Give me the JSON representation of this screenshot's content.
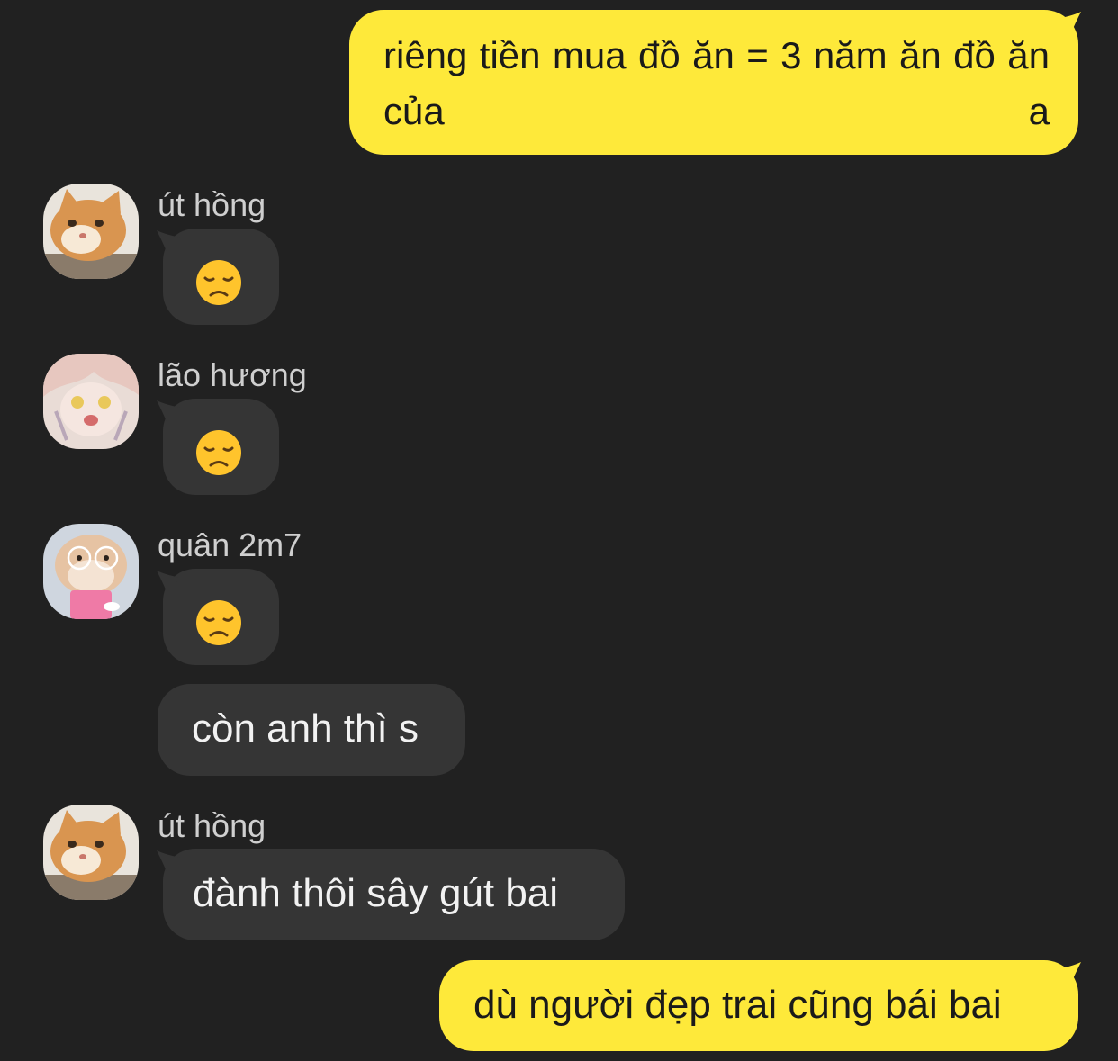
{
  "messages": {
    "m1": {
      "text": "riêng tiền mua đồ ăn = 3 năm ăn đồ ăn của a"
    },
    "m2": {
      "sender": "út hồng",
      "emoji": "disappointed-face"
    },
    "m3": {
      "sender": "lão hương",
      "emoji": "disappointed-face"
    },
    "m4": {
      "sender": "quân 2m7",
      "emoji": "disappointed-face"
    },
    "m5": {
      "text": "còn anh thì s"
    },
    "m6": {
      "sender": "út hồng",
      "text": "đành thôi sây gút bai"
    },
    "m7": {
      "text": "dù người đẹp trai cũng bái bai"
    }
  },
  "colors": {
    "background": "#212121",
    "outgoing_bubble": "#fee93a",
    "incoming_bubble": "#353535"
  }
}
